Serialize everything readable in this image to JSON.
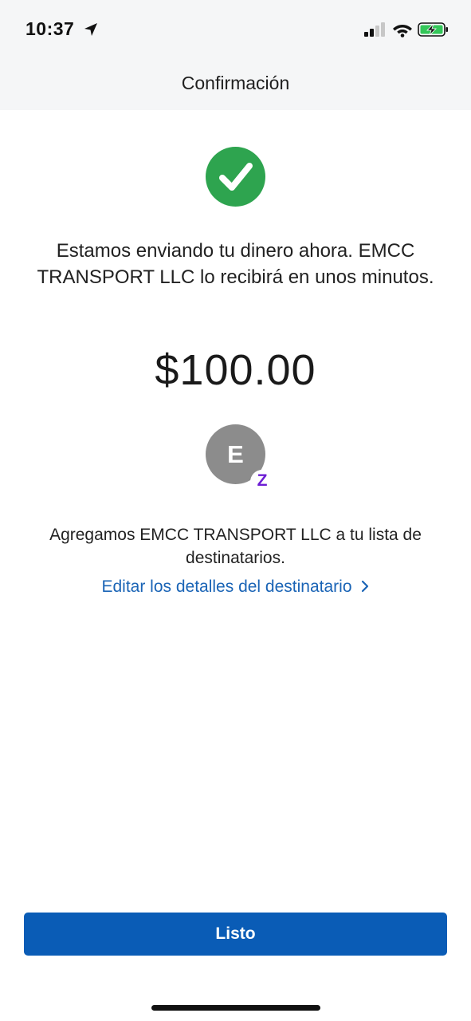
{
  "status_bar": {
    "time": "10:37",
    "location_icon": "location-arrow-icon",
    "signal_icon": "cellular-signal-icon",
    "wifi_icon": "wifi-icon",
    "battery_icon": "battery-charging-icon",
    "battery_color": "#34c759"
  },
  "nav": {
    "title": "Confirmación"
  },
  "confirmation": {
    "icon": "checkmark-circle-icon",
    "icon_color": "#2ea44f",
    "message": "Estamos enviando tu dinero ahora. EMCC TRANSPORT LLC lo recibirá en unos minutos.",
    "amount": "$100.00"
  },
  "recipient": {
    "avatar_letter": "E",
    "badge_icon": "zelle-icon",
    "badge_glyph": "Z",
    "added_text": "Agregamos EMCC TRANSPORT LLC a tu lista de destinatarios.",
    "edit_link": "Editar los detalles del destinatario"
  },
  "footer": {
    "done_label": "Listo",
    "button_color": "#0a5cb6"
  }
}
